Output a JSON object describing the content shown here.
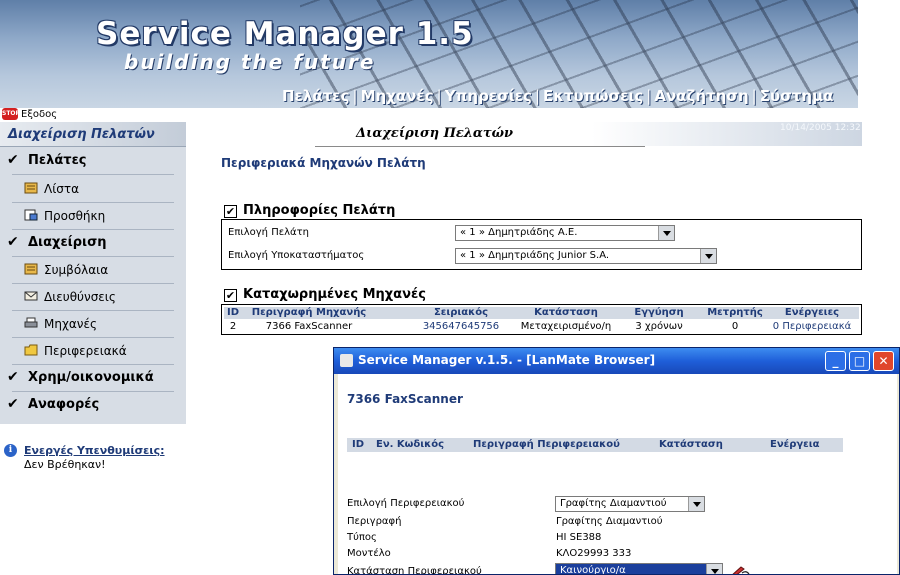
{
  "header": {
    "title": "Service Manager 1.5",
    "tagline": "building the future",
    "nav": [
      "Πελάτες",
      "Μηχανές",
      "Υπηρεσίες",
      "Εκτυπώσεις",
      "Αναζήτηση",
      "Σύστημα"
    ],
    "exit_label": "Εξοδος",
    "stop_text": "STOP"
  },
  "sidebar": {
    "title": "Διαχείριση Πελατών",
    "groups": [
      {
        "label": "Πελάτες",
        "items": [
          "Λίστα",
          "Προσθήκη"
        ]
      },
      {
        "label": "Διαχείριση",
        "items": [
          "Συμβόλαια",
          "Διευθύνσεις",
          "Μηχανές",
          "Περιφερειακά"
        ]
      },
      {
        "label": "Χρημ/οικονομικά",
        "items": []
      },
      {
        "label": "Αναφορές",
        "items": []
      }
    ],
    "reminders_label": "Ενεργές Υπενθυμίσεις:",
    "reminders_value": "Δεν Βρέθηκαν!"
  },
  "main": {
    "title": "Διαχείριση Πελατών",
    "datetime": "10/14/2005 12:32",
    "subtitle": "Περιφεριακά Μηχανών Πελάτη",
    "client_info": {
      "heading": "Πληροφορίες Πελάτη",
      "client_label": "Επιλογή Πελάτη",
      "client_value": "« 1 » Δημητριάδης Α.Ε.",
      "branch_label": "Επιλογή Υποκαταστήματος",
      "branch_value": "« 1 » Δημητριάδης Junior S.A."
    },
    "machines": {
      "heading": "Καταχωρημένες Μηχανές",
      "columns": [
        "ID",
        "Περιγραφή Μηχανής",
        "Σειριακός",
        "Κατάσταση",
        "Εγγύηση",
        "Μετρητής",
        "Ενέργειες"
      ],
      "rows": [
        [
          "2",
          "7366 FaxScanner",
          "345647645756",
          "Μεταχειρισμένο/η",
          "3 χρόνων",
          "0",
          "0 Περιφερειακά"
        ]
      ]
    }
  },
  "popup": {
    "title": "Service Manager v.1.5. - [LanMate Browser]",
    "machine_name": "7366 FaxScanner",
    "columns": [
      "ID",
      "Εν. Κωδικός",
      "Περιγραφή Περιφερειακού",
      "Κατάσταση",
      "Ενέργεια"
    ],
    "fields": {
      "peripheral_label": "Επιλογή Περιφερειακού",
      "peripheral_value": "Γραφίτης Διαμαντιού",
      "description_label": "Περιγραφή",
      "description_value": "Γραφίτης Διαμαντιού",
      "type_label": "Τύπος",
      "type_value": "HI SE388",
      "model_label": "Μοντέλο",
      "model_value": "ΚΛΟ29993 333",
      "state_label": "Κατάσταση Περιφερειακού",
      "state_value": "Καινούργιο/α"
    }
  },
  "colors": {
    "accent": "#1f3b78",
    "sidebar_bg": "#d7dde5",
    "table_header_bg": "#d3dae4",
    "xp_titlebar": "#1f5fd9",
    "selected_bg": "#1b3f9c"
  }
}
